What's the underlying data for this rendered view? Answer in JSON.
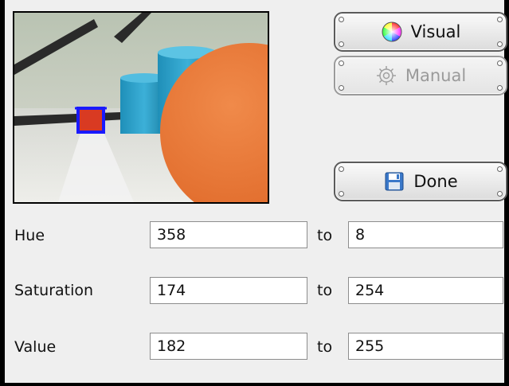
{
  "camera": {
    "description_icon": "camera-preview"
  },
  "buttons": {
    "visual": {
      "label": "Visual",
      "icon": "color-wheel-icon",
      "enabled": true
    },
    "manual": {
      "label": "Manual",
      "icon": "gear-icon",
      "enabled": false
    },
    "done": {
      "label": "Done",
      "icon": "floppy-save-icon",
      "enabled": true
    }
  },
  "ranges": {
    "to_label": "to",
    "hue": {
      "label": "Hue",
      "from": "358",
      "to": "8"
    },
    "saturation": {
      "label": "Saturation",
      "from": "174",
      "to": "254"
    },
    "value": {
      "label": "Value",
      "from": "182",
      "to": "255"
    }
  },
  "colors": {
    "selection_box": "#1a1aff",
    "target_object": "#d93a22"
  }
}
